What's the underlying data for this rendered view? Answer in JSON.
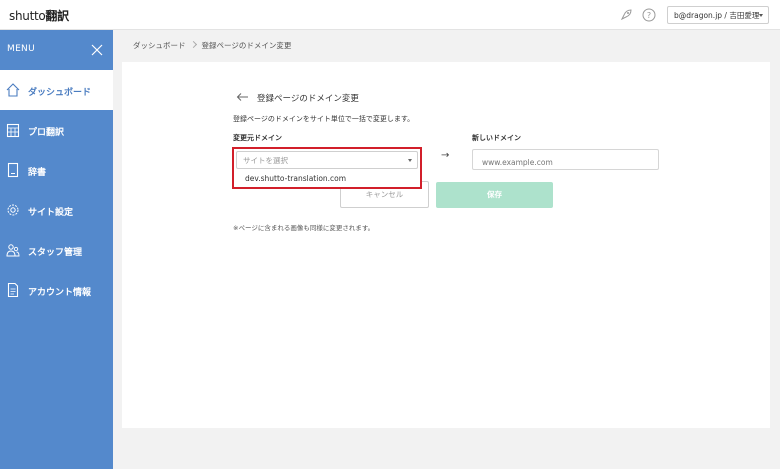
{
  "app": {
    "logo": "shutto",
    "logo_suffix": "翻訳"
  },
  "user": {
    "account_label": "b@dragon.jp / 吉田愛理"
  },
  "sidebar": {
    "menu_label": "MENU",
    "items": [
      {
        "label": "ダッシュボード",
        "icon": "home-icon",
        "active": true
      },
      {
        "label": "プロ翻訳",
        "icon": "calendar-grid-icon",
        "active": false
      },
      {
        "label": "辞書",
        "icon": "book-icon",
        "active": false
      },
      {
        "label": "サイト設定",
        "icon": "gear-icon",
        "active": false
      },
      {
        "label": "スタッフ管理",
        "icon": "staff-icon",
        "active": false
      },
      {
        "label": "アカウント情報",
        "icon": "document-icon",
        "active": false
      }
    ]
  },
  "breadcrumb": {
    "root": "ダッシュボード",
    "current": "登録ページのドメイン変更"
  },
  "page": {
    "title": "登録ページのドメイン変更",
    "description": "登録ページのドメインをサイト単位で一括で変更します。",
    "source_label": "変更元ドメイン",
    "new_label": "新しいドメイン",
    "arrow": "→",
    "select_placeholder": "サイトを選択",
    "dropdown_option": "dev.shutto-translation.com",
    "new_domain_placeholder": "www.example.com",
    "cancel_label": "キャンセル",
    "save_label": "保存",
    "note": "※ページに含まれる画像も同様に変更されます。"
  },
  "colors": {
    "sidebar": "#5489cc",
    "save_button": "#ade2cc",
    "highlight": "#d21f2a"
  }
}
